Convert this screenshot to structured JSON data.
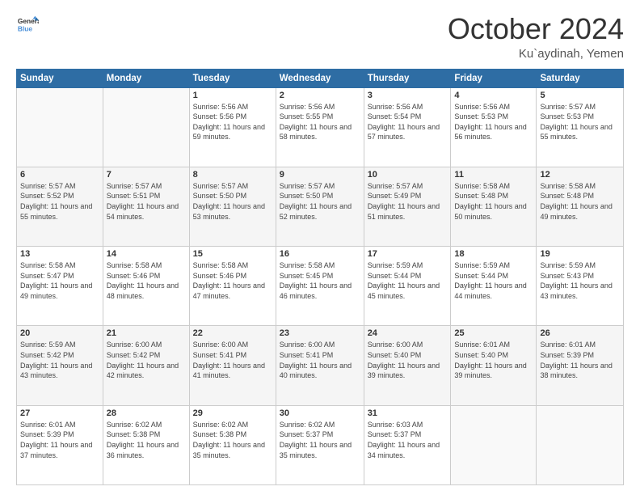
{
  "header": {
    "logo_general": "General",
    "logo_blue": "Blue",
    "month": "October 2024",
    "location": "Ku`aydinah, Yemen"
  },
  "days_of_week": [
    "Sunday",
    "Monday",
    "Tuesday",
    "Wednesday",
    "Thursday",
    "Friday",
    "Saturday"
  ],
  "weeks": [
    [
      {
        "day": "",
        "info": ""
      },
      {
        "day": "",
        "info": ""
      },
      {
        "day": "1",
        "info": "Sunrise: 5:56 AM\nSunset: 5:56 PM\nDaylight: 11 hours and 59 minutes."
      },
      {
        "day": "2",
        "info": "Sunrise: 5:56 AM\nSunset: 5:55 PM\nDaylight: 11 hours and 58 minutes."
      },
      {
        "day": "3",
        "info": "Sunrise: 5:56 AM\nSunset: 5:54 PM\nDaylight: 11 hours and 57 minutes."
      },
      {
        "day": "4",
        "info": "Sunrise: 5:56 AM\nSunset: 5:53 PM\nDaylight: 11 hours and 56 minutes."
      },
      {
        "day": "5",
        "info": "Sunrise: 5:57 AM\nSunset: 5:53 PM\nDaylight: 11 hours and 55 minutes."
      }
    ],
    [
      {
        "day": "6",
        "info": "Sunrise: 5:57 AM\nSunset: 5:52 PM\nDaylight: 11 hours and 55 minutes."
      },
      {
        "day": "7",
        "info": "Sunrise: 5:57 AM\nSunset: 5:51 PM\nDaylight: 11 hours and 54 minutes."
      },
      {
        "day": "8",
        "info": "Sunrise: 5:57 AM\nSunset: 5:50 PM\nDaylight: 11 hours and 53 minutes."
      },
      {
        "day": "9",
        "info": "Sunrise: 5:57 AM\nSunset: 5:50 PM\nDaylight: 11 hours and 52 minutes."
      },
      {
        "day": "10",
        "info": "Sunrise: 5:57 AM\nSunset: 5:49 PM\nDaylight: 11 hours and 51 minutes."
      },
      {
        "day": "11",
        "info": "Sunrise: 5:58 AM\nSunset: 5:48 PM\nDaylight: 11 hours and 50 minutes."
      },
      {
        "day": "12",
        "info": "Sunrise: 5:58 AM\nSunset: 5:48 PM\nDaylight: 11 hours and 49 minutes."
      }
    ],
    [
      {
        "day": "13",
        "info": "Sunrise: 5:58 AM\nSunset: 5:47 PM\nDaylight: 11 hours and 49 minutes."
      },
      {
        "day": "14",
        "info": "Sunrise: 5:58 AM\nSunset: 5:46 PM\nDaylight: 11 hours and 48 minutes."
      },
      {
        "day": "15",
        "info": "Sunrise: 5:58 AM\nSunset: 5:46 PM\nDaylight: 11 hours and 47 minutes."
      },
      {
        "day": "16",
        "info": "Sunrise: 5:58 AM\nSunset: 5:45 PM\nDaylight: 11 hours and 46 minutes."
      },
      {
        "day": "17",
        "info": "Sunrise: 5:59 AM\nSunset: 5:44 PM\nDaylight: 11 hours and 45 minutes."
      },
      {
        "day": "18",
        "info": "Sunrise: 5:59 AM\nSunset: 5:44 PM\nDaylight: 11 hours and 44 minutes."
      },
      {
        "day": "19",
        "info": "Sunrise: 5:59 AM\nSunset: 5:43 PM\nDaylight: 11 hours and 43 minutes."
      }
    ],
    [
      {
        "day": "20",
        "info": "Sunrise: 5:59 AM\nSunset: 5:42 PM\nDaylight: 11 hours and 43 minutes."
      },
      {
        "day": "21",
        "info": "Sunrise: 6:00 AM\nSunset: 5:42 PM\nDaylight: 11 hours and 42 minutes."
      },
      {
        "day": "22",
        "info": "Sunrise: 6:00 AM\nSunset: 5:41 PM\nDaylight: 11 hours and 41 minutes."
      },
      {
        "day": "23",
        "info": "Sunrise: 6:00 AM\nSunset: 5:41 PM\nDaylight: 11 hours and 40 minutes."
      },
      {
        "day": "24",
        "info": "Sunrise: 6:00 AM\nSunset: 5:40 PM\nDaylight: 11 hours and 39 minutes."
      },
      {
        "day": "25",
        "info": "Sunrise: 6:01 AM\nSunset: 5:40 PM\nDaylight: 11 hours and 39 minutes."
      },
      {
        "day": "26",
        "info": "Sunrise: 6:01 AM\nSunset: 5:39 PM\nDaylight: 11 hours and 38 minutes."
      }
    ],
    [
      {
        "day": "27",
        "info": "Sunrise: 6:01 AM\nSunset: 5:39 PM\nDaylight: 11 hours and 37 minutes."
      },
      {
        "day": "28",
        "info": "Sunrise: 6:02 AM\nSunset: 5:38 PM\nDaylight: 11 hours and 36 minutes."
      },
      {
        "day": "29",
        "info": "Sunrise: 6:02 AM\nSunset: 5:38 PM\nDaylight: 11 hours and 35 minutes."
      },
      {
        "day": "30",
        "info": "Sunrise: 6:02 AM\nSunset: 5:37 PM\nDaylight: 11 hours and 35 minutes."
      },
      {
        "day": "31",
        "info": "Sunrise: 6:03 AM\nSunset: 5:37 PM\nDaylight: 11 hours and 34 minutes."
      },
      {
        "day": "",
        "info": ""
      },
      {
        "day": "",
        "info": ""
      }
    ]
  ]
}
